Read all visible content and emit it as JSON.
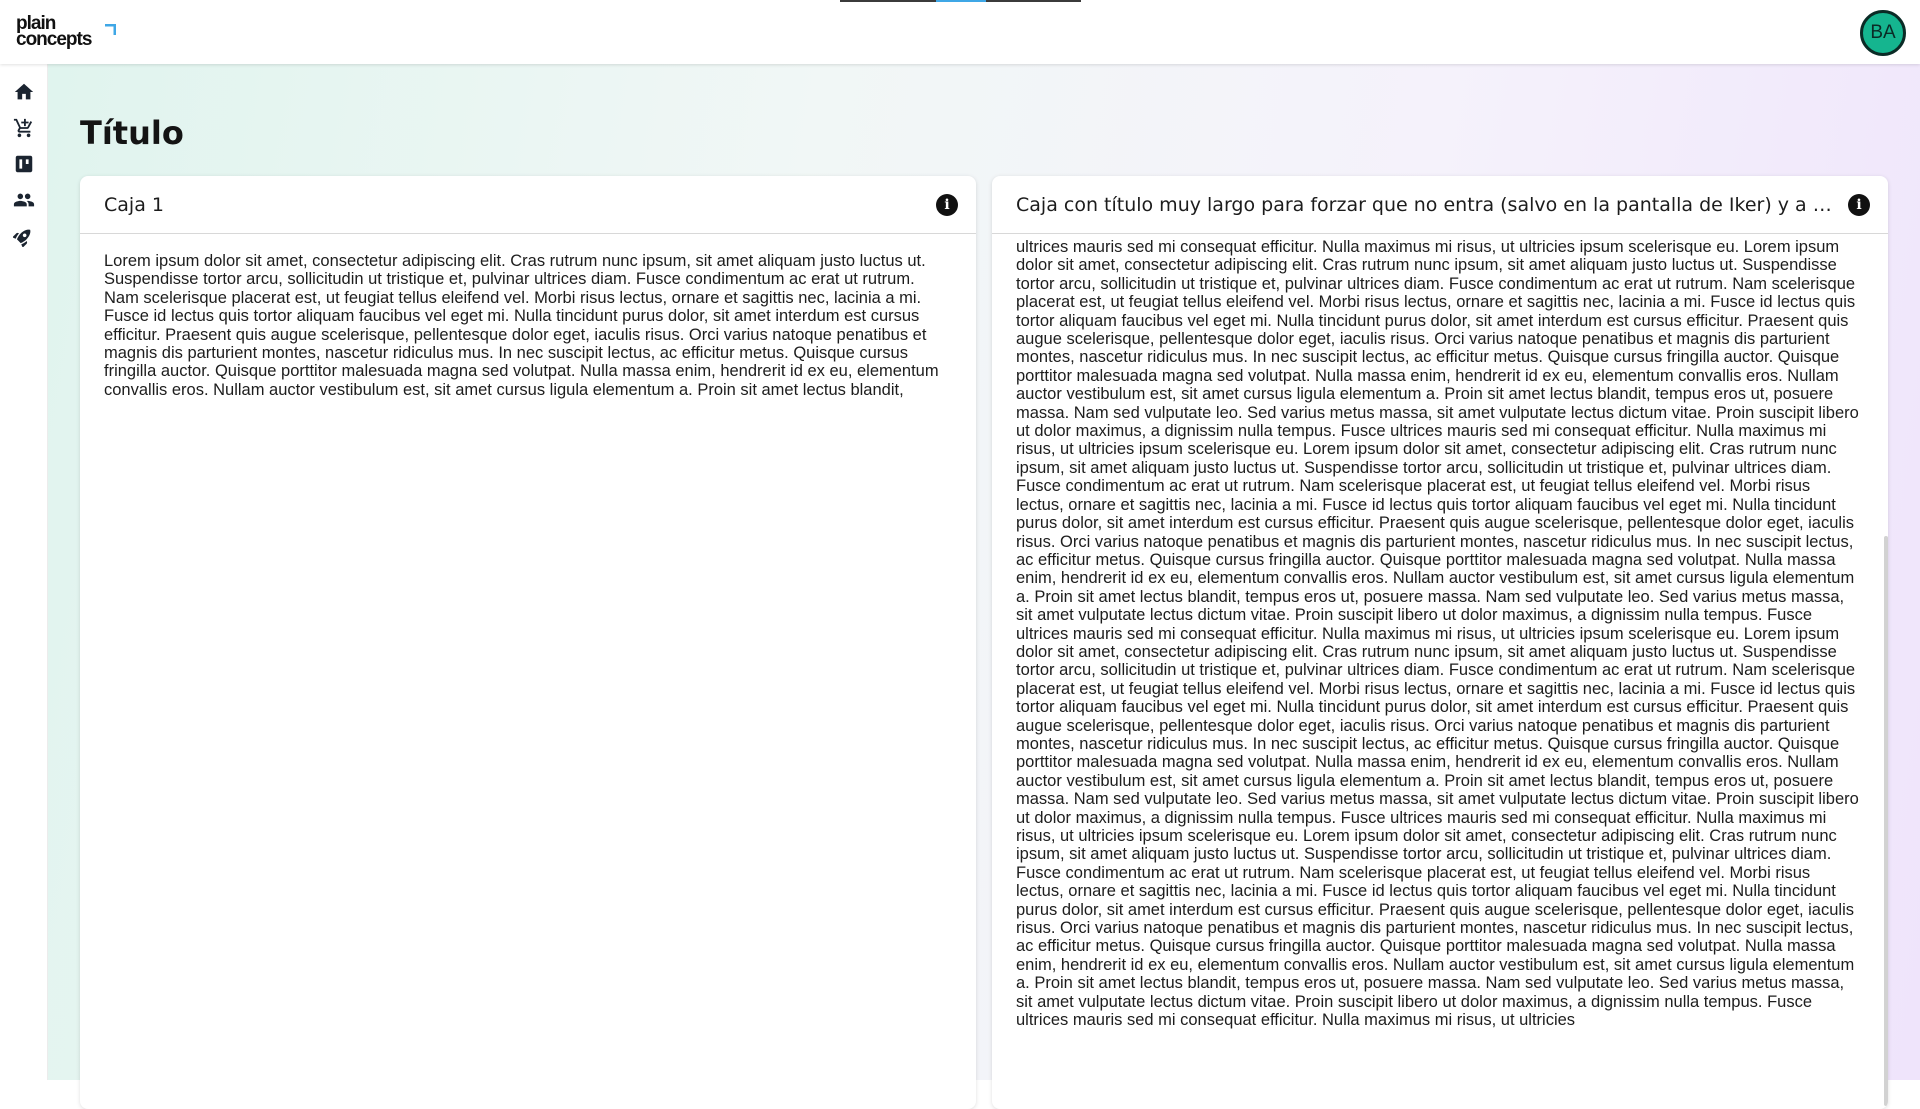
{
  "app": {
    "logo_line1": "plain",
    "logo_line2": "concepts",
    "avatar_initials": "BA",
    "accent_color": "#15b58f",
    "logo_mark_color": "#3fa7e6"
  },
  "sidebar": {
    "items": [
      {
        "icon": "home-icon"
      },
      {
        "icon": "cart-icon"
      },
      {
        "icon": "board-icon"
      },
      {
        "icon": "people-icon"
      },
      {
        "icon": "rocket-icon"
      }
    ]
  },
  "page": {
    "title": "Título"
  },
  "cards": [
    {
      "title": "Caja 1",
      "icon": "info-icon",
      "body": "Lorem ipsum dolor sit amet, consectetur adipiscing elit. Cras rutrum nunc ipsum, sit amet aliquam justo luctus ut. Suspendisse tortor arcu, sollicitudin ut tristique et, pulvinar ultrices diam. Fusce condimentum ac erat ut rutrum. Nam scelerisque placerat est, ut feugiat tellus eleifend vel. Morbi risus lectus, ornare et sagittis nec, lacinia a mi. Fusce id lectus quis tortor aliquam faucibus vel eget mi. Nulla tincidunt purus dolor, sit amet interdum est cursus efficitur. Praesent quis augue scelerisque, pellentesque dolor eget, iaculis risus. Orci varius natoque penatibus et magnis dis parturient montes, nascetur ridiculus mus. In nec suscipit lectus, ac efficitur metus. Quisque cursus fringilla auctor. Quisque porttitor malesuada magna sed volutpat. Nulla massa enim, hendrerit id ex eu, elementum convallis eros. Nullam auctor vestibulum est, sit amet cursus ligula elementum a. Proin sit amet lectus blandit,"
    },
    {
      "title": "Caja con título muy largo para forzar que no entra (salvo en la pantalla de Iker) y a ver qu...",
      "icon": "info-icon",
      "body": "ultrices mauris sed mi consequat efficitur. Nulla maximus mi risus, ut ultricies ipsum scelerisque eu. Lorem ipsum dolor sit amet, consectetur adipiscing elit. Cras rutrum nunc ipsum, sit amet aliquam justo luctus ut. Suspendisse tortor arcu, sollicitudin ut tristique et, pulvinar ultrices diam. Fusce condimentum ac erat ut rutrum. Nam scelerisque placerat est, ut feugiat tellus eleifend vel. Morbi risus lectus, ornare et sagittis nec, lacinia a mi. Fusce id lectus quis tortor aliquam faucibus vel eget mi. Nulla tincidunt purus dolor, sit amet interdum est cursus efficitur. Praesent quis augue scelerisque, pellentesque dolor eget, iaculis risus. Orci varius natoque penatibus et magnis dis parturient montes, nascetur ridiculus mus. In nec suscipit lectus, ac efficitur metus. Quisque cursus fringilla auctor. Quisque porttitor malesuada magna sed volutpat. Nulla massa enim, hendrerit id ex eu, elementum convallis eros. Nullam auctor vestibulum est, sit amet cursus ligula elementum a. Proin sit amet lectus blandit, tempus eros ut, posuere massa. Nam sed vulputate leo. Sed varius metus massa, sit amet vulputate lectus dictum vitae. Proin suscipit libero ut dolor maximus, a dignissim nulla tempus. Fusce ultrices mauris sed mi consequat efficitur. Nulla maximus mi risus, ut ultricies ipsum scelerisque eu. Lorem ipsum dolor sit amet, consectetur adipiscing elit. Cras rutrum nunc ipsum, sit amet aliquam justo luctus ut. Suspendisse tortor arcu, sollicitudin ut tristique et, pulvinar ultrices diam. Fusce condimentum ac erat ut rutrum. Nam scelerisque placerat est, ut feugiat tellus eleifend vel. Morbi risus lectus, ornare et sagittis nec, lacinia a mi. Fusce id lectus quis tortor aliquam faucibus vel eget mi. Nulla tincidunt purus dolor, sit amet interdum est cursus efficitur. Praesent quis augue scelerisque, pellentesque dolor eget, iaculis risus. Orci varius natoque penatibus et magnis dis parturient montes, nascetur ridiculus mus. In nec suscipit lectus, ac efficitur metus. Quisque cursus fringilla auctor. Quisque porttitor malesuada magna sed volutpat. Nulla massa enim, hendrerit id ex eu, elementum convallis eros. Nullam auctor vestibulum est, sit amet cursus ligula elementum a. Proin sit amet lectus blandit, tempus eros ut, posuere massa. Nam sed vulputate leo. Sed varius metus massa, sit amet vulputate lectus dictum vitae. Proin suscipit libero ut dolor maximus, a dignissim nulla tempus. Fusce ultrices mauris sed mi consequat efficitur. Nulla maximus mi risus, ut ultricies ipsum scelerisque eu. Lorem ipsum dolor sit amet, consectetur adipiscing elit. Cras rutrum nunc ipsum, sit amet aliquam justo luctus ut. Suspendisse tortor arcu, sollicitudin ut tristique et, pulvinar ultrices diam. Fusce condimentum ac erat ut rutrum. Nam scelerisque placerat est, ut feugiat tellus eleifend vel. Morbi risus lectus, ornare et sagittis nec, lacinia a mi. Fusce id lectus quis tortor aliquam faucibus vel eget mi. Nulla tincidunt purus dolor, sit amet interdum est cursus efficitur. Praesent quis augue scelerisque, pellentesque dolor eget, iaculis risus. Orci varius natoque penatibus et magnis dis parturient montes, nascetur ridiculus mus. In nec suscipit lectus, ac efficitur metus. Quisque cursus fringilla auctor. Quisque porttitor malesuada magna sed volutpat. Nulla massa enim, hendrerit id ex eu, elementum convallis eros. Nullam auctor vestibulum est, sit amet cursus ligula elementum a. Proin sit amet lectus blandit, tempus eros ut, posuere massa. Nam sed vulputate leo. Sed varius metus massa, sit amet vulputate lectus dictum vitae. Proin suscipit libero ut dolor maximus, a dignissim nulla tempus. Fusce ultrices mauris sed mi consequat efficitur. Nulla maximus mi risus, ut ultricies ipsum scelerisque eu. Lorem ipsum dolor sit amet, consectetur adipiscing elit. Cras rutrum nunc ipsum, sit amet aliquam justo luctus ut. Suspendisse tortor arcu, sollicitudin ut tristique et, pulvinar ultrices diam. Fusce condimentum ac erat ut rutrum. Nam scelerisque placerat est, ut feugiat tellus eleifend vel. Morbi risus lectus, ornare et sagittis nec, lacinia a mi. Fusce id lectus quis tortor aliquam faucibus vel eget mi. Nulla tincidunt purus dolor, sit amet interdum est cursus efficitur. Praesent quis augue scelerisque, pellentesque dolor eget, iaculis risus. Orci varius natoque penatibus et magnis dis parturient montes, nascetur ridiculus mus. In nec suscipit lectus, ac efficitur metus. Quisque cursus fringilla auctor. Quisque porttitor malesuada magna sed volutpat. Nulla massa enim, hendrerit id ex eu, elementum convallis eros. Nullam auctor vestibulum est, sit amet cursus ligula elementum a. Proin sit amet lectus blandit, tempus eros ut, posuere massa. Nam sed vulputate leo. Sed varius metus massa, sit amet vulputate lectus dictum vitae. Proin suscipit libero ut dolor maximus, a dignissim nulla tempus. Fusce ultrices mauris sed mi consequat efficitur. Nulla maximus mi risus, ut ultricies"
    }
  ]
}
